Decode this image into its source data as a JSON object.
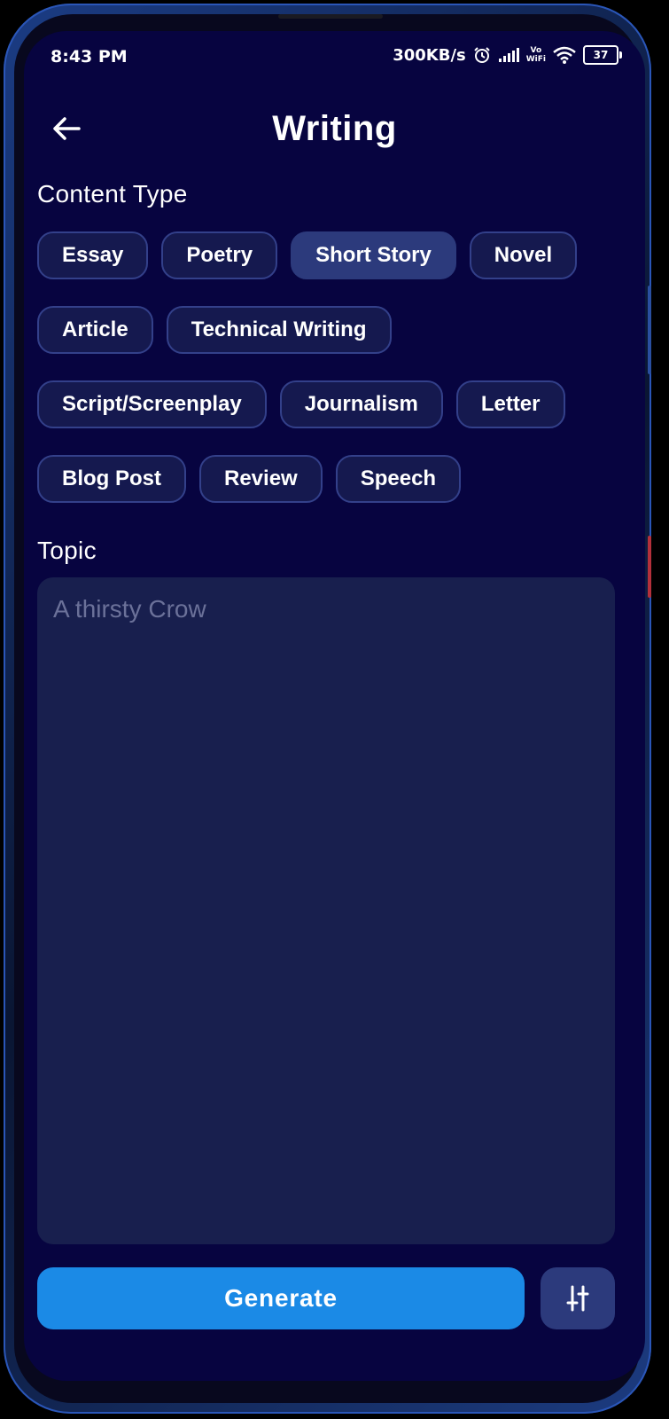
{
  "status_bar": {
    "time": "8:43 PM",
    "network_speed": "300KB/s",
    "volte_top": "Vo",
    "volte_bottom": "WiFi",
    "battery": "37",
    "icons": [
      "alarm-icon",
      "signal-icon",
      "volte-wifi-icon",
      "wifi-icon",
      "battery-icon"
    ]
  },
  "header": {
    "title": "Writing",
    "back_icon": "arrow-left-icon"
  },
  "content_type": {
    "label": "Content Type",
    "rows": [
      [
        {
          "label": "Essay",
          "selected": false
        },
        {
          "label": "Poetry",
          "selected": false
        },
        {
          "label": "Short Story",
          "selected": true
        },
        {
          "label": "Novel",
          "selected": false
        }
      ],
      [
        {
          "label": "Article",
          "selected": false
        },
        {
          "label": "Technical Writing",
          "selected": false
        }
      ],
      [
        {
          "label": "Script/Screenplay",
          "selected": false
        },
        {
          "label": "Journalism",
          "selected": false
        },
        {
          "label": "Letter",
          "selected": false
        }
      ],
      [
        {
          "label": "Blog Post",
          "selected": false
        },
        {
          "label": "Review",
          "selected": false
        },
        {
          "label": "Speech",
          "selected": false
        }
      ]
    ]
  },
  "topic": {
    "label": "Topic",
    "value": "",
    "placeholder": "A thirsty Crow"
  },
  "actions": {
    "generate_label": "Generate",
    "settings_icon": "sliders-icon"
  },
  "colors": {
    "background": "#070440",
    "chip": "#15194f",
    "chip_selected": "#2c3a7c",
    "input": "#181f4e",
    "primary": "#1b8ae6"
  }
}
